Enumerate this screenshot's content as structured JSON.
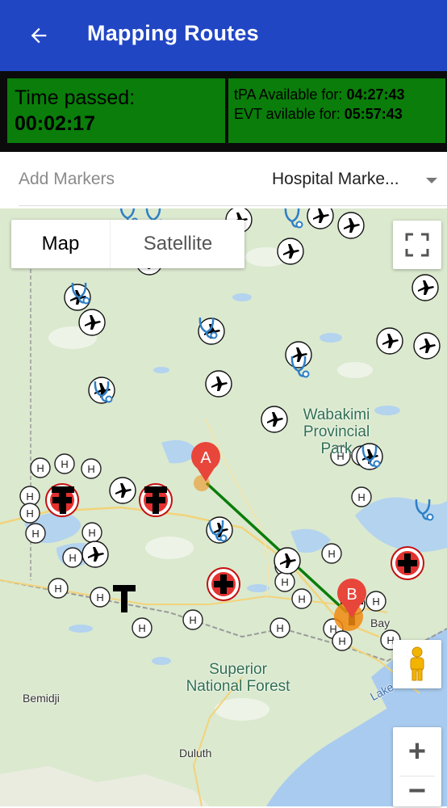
{
  "header": {
    "title": "Mapping Routes",
    "back_icon": "arrow-left-icon",
    "background": "#2146c4"
  },
  "timer": {
    "time_passed_label": "Time passed:",
    "time_passed_value": "00:02:17",
    "tpa_label": "tPA Available for:",
    "tpa_value": "04:27:43",
    "evt_label": "EVT avilable for:",
    "evt_value": "05:57:43",
    "box_color": "#0a7d0a"
  },
  "markers": {
    "add_label": "Add Markers",
    "selected": "Hospital Marke..."
  },
  "map": {
    "type_map": "Map",
    "type_satellite": "Satellite",
    "labels": {
      "park_line1": "Wabakimi",
      "park_line2": "Provincial",
      "park_line3": "Park",
      "forest_line1": "Superior",
      "forest_line2": "National Forest",
      "bemidji": "Bemidji",
      "duluth": "Duluth",
      "bay": "Bay",
      "lake": "Lake"
    },
    "marker_a": "A",
    "marker_b": "B",
    "route_color": "#0a7d0a",
    "zoom_in": "+",
    "zoom_out": "−",
    "icons": [
      "fullscreen-icon",
      "pegman-icon",
      "airplane-icon",
      "hospital-icon",
      "stethoscope-icon",
      "red-cross-icon",
      "t-marker-icon"
    ]
  }
}
